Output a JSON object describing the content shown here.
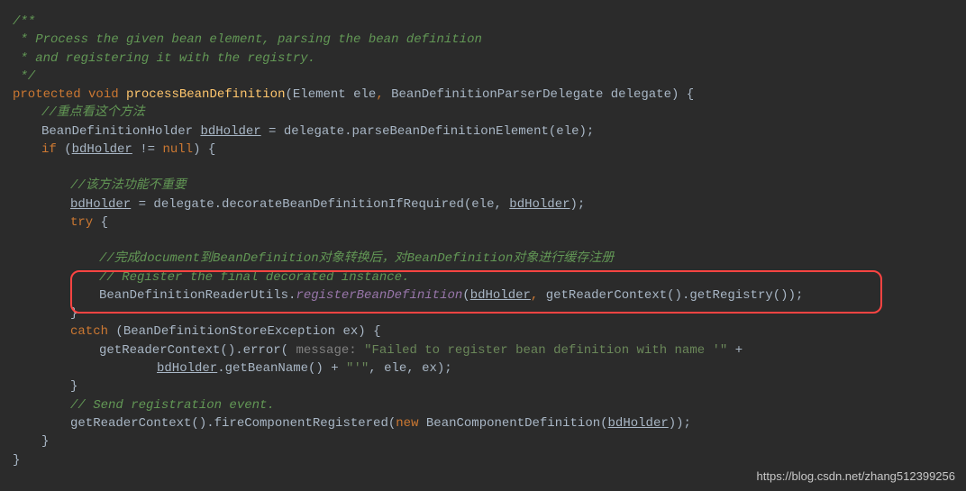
{
  "code": {
    "c1": "/**",
    "c2": " * Process the given bean element, parsing the bean definition",
    "c3": " * and registering it with the registry.",
    "c4": " */",
    "kw_protected": "protected",
    "kw_void": "void",
    "method_name": "processBeanDefinition",
    "sig_open": "(",
    "type_element": "Element",
    "param_ele": " ele",
    "comma1": ", ",
    "type_delegate": "BeanDefinitionParserDelegate",
    "param_delegate": " delegate",
    "sig_close": ") {",
    "c5": "//重点看这个方法",
    "l1_a": "BeanDefinitionHolder ",
    "l1_b": "bdHolder",
    "l1_c": " = delegate.parseBeanDefinitionElement(ele);",
    "kw_if": "if",
    "l2_a": " (",
    "l2_b": "bdHolder",
    "l2_c": " != ",
    "kw_null": "null",
    "l2_d": ") {",
    "c6": "//该方法功能不重要",
    "l3_a": "bdHolder",
    "l3_b": " = delegate.decorateBeanDefinitionIfRequired(ele, ",
    "l3_c": "bdHolder",
    "l3_d": ");",
    "kw_try": "try",
    "l4_a": " {",
    "c7": "//完成document到BeanDefinition对象转换后，对BeanDefinition对象进行缓存注册",
    "c8": "// Register the final decorated instance.",
    "l5_a": "BeanDefinitionReaderUtils.",
    "l5_m": "registerBeanDefinition",
    "l5_b": "(",
    "l5_c": "bdHolder",
    "l5_d": ", ",
    "l5_e": "getReaderContext().getRegistry());",
    "brace_close": "}",
    "kw_catch": "catch",
    "l6_a": " (BeanDefinitionStoreException ex) {",
    "l7_a": "getReaderContext().error(",
    "l7_hint": " message: ",
    "l7_s1": "\"Failed to register bean definition with name '\"",
    "l7_b": " +",
    "l8_a": "bdHolder",
    "l8_b": ".getBeanName() + ",
    "l8_s1": "\"'\"",
    "l8_c": ", ele, ex);",
    "c9": "// Send registration event.",
    "l9_a": "getReaderContext().fireComponentRegistered(",
    "kw_new": "new",
    "l9_b": " BeanComponentDefinition(",
    "l9_c": "bdHolder",
    "l9_d": "));"
  },
  "watermark": "https://blog.csdn.net/zhang512399256"
}
